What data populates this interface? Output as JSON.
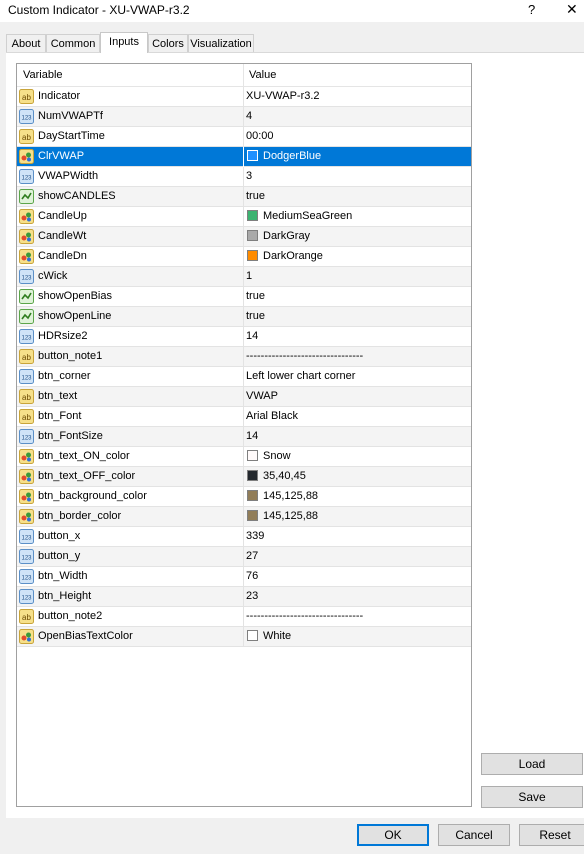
{
  "window": {
    "title": "Custom Indicator - XU-VWAP-r3.2",
    "help_glyph": "?",
    "close_glyph": "✕"
  },
  "tabs": [
    {
      "label": "About"
    },
    {
      "label": "Common"
    },
    {
      "label": "Inputs",
      "active": true
    },
    {
      "label": "Colors"
    },
    {
      "label": "Visualization"
    }
  ],
  "grid": {
    "header": {
      "variable": "Variable",
      "value": "Value"
    },
    "rows": [
      {
        "name": "Indicator",
        "value": "XU-VWAP-r3.2",
        "type": "ab"
      },
      {
        "name": "NumVWAPTf",
        "value": "4",
        "type": "123"
      },
      {
        "name": "DayStartTime",
        "value": "00:00",
        "type": "ab"
      },
      {
        "name": "ClrVWAP",
        "value": "DodgerBlue",
        "type": "color",
        "color": "#1e90ff",
        "selected": true
      },
      {
        "name": "VWAPWidth",
        "value": "3",
        "type": "123"
      },
      {
        "name": "showCANDLES",
        "value": "true",
        "type": "bool"
      },
      {
        "name": "CandleUp",
        "value": "MediumSeaGreen",
        "type": "color",
        "color": "#3cb371"
      },
      {
        "name": "CandleWt",
        "value": "DarkGray",
        "type": "color",
        "color": "#a9a9a9"
      },
      {
        "name": "CandleDn",
        "value": "DarkOrange",
        "type": "color",
        "color": "#ff8c00"
      },
      {
        "name": "cWick",
        "value": "1",
        "type": "123"
      },
      {
        "name": "showOpenBias",
        "value": "true",
        "type": "bool"
      },
      {
        "name": "showOpenLine",
        "value": "true",
        "type": "bool"
      },
      {
        "name": "HDRsize2",
        "value": "14",
        "type": "123"
      },
      {
        "name": "button_note1",
        "value": "--------------------------------",
        "type": "ab"
      },
      {
        "name": "btn_corner",
        "value": "Left lower chart corner",
        "type": "123"
      },
      {
        "name": "btn_text",
        "value": "VWAP",
        "type": "ab"
      },
      {
        "name": "btn_Font",
        "value": "Arial Black",
        "type": "ab"
      },
      {
        "name": "btn_FontSize",
        "value": "14",
        "type": "123"
      },
      {
        "name": "btn_text_ON_color",
        "value": "Snow",
        "type": "color",
        "color": "#fffafa"
      },
      {
        "name": "btn_text_OFF_color",
        "value": "35,40,45",
        "type": "color",
        "color": "#23282d"
      },
      {
        "name": "btn_background_color",
        "value": "145,125,88",
        "type": "color",
        "color": "#917d58"
      },
      {
        "name": "btn_border_color",
        "value": "145,125,88",
        "type": "color",
        "color": "#917d58"
      },
      {
        "name": "button_x",
        "value": "339",
        "type": "123"
      },
      {
        "name": "button_y",
        "value": "27",
        "type": "123"
      },
      {
        "name": "btn_Width",
        "value": "76",
        "type": "123"
      },
      {
        "name": "btn_Height",
        "value": "23",
        "type": "123"
      },
      {
        "name": "button_note2",
        "value": "--------------------------------",
        "type": "ab"
      },
      {
        "name": "OpenBiasTextColor",
        "value": "White",
        "type": "color",
        "color": "#ffffff"
      }
    ]
  },
  "side_buttons": {
    "load": "Load",
    "save": "Save"
  },
  "footer_buttons": {
    "ok": "OK",
    "cancel": "Cancel",
    "reset": "Reset"
  }
}
